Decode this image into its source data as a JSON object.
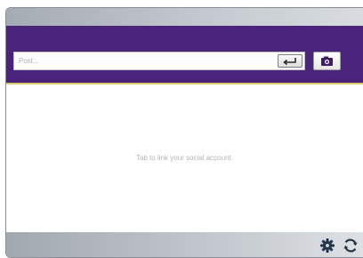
{
  "post": {
    "placeholder": "Post..."
  },
  "content": {
    "message": "Tab to link your social account."
  },
  "icons": {
    "enter": "enter-icon",
    "camera": "camera-icon",
    "settings": "gear-icon",
    "refresh": "refresh-icon"
  },
  "colors": {
    "header": "#4a237a",
    "accent_line": "#d8c96a"
  }
}
